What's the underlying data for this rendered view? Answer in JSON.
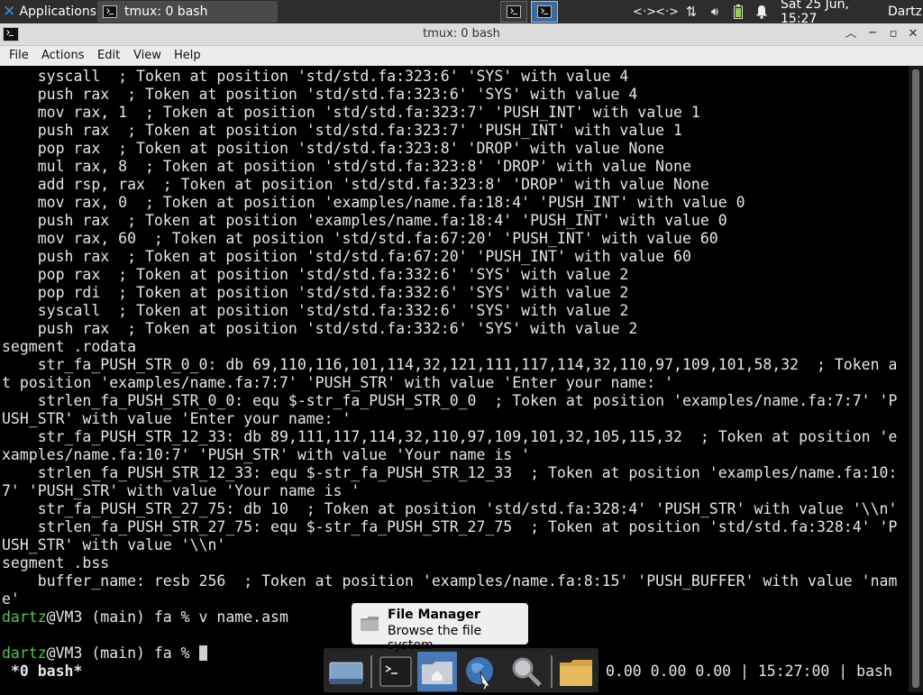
{
  "panel": {
    "applications_label": "Applications",
    "task_title": "tmux: 0 bash",
    "clock": "Sat 25 Jun, 15:27",
    "user": "Dartz"
  },
  "window": {
    "title": "tmux: 0 bash",
    "menu": [
      "File",
      "Actions",
      "Edit",
      "View",
      "Help"
    ]
  },
  "terminal": {
    "lines": [
      "    syscall  ; Token at position 'std/std.fa:323:6' 'SYS' with value 4",
      "    push rax  ; Token at position 'std/std.fa:323:6' 'SYS' with value 4",
      "    mov rax, 1  ; Token at position 'std/std.fa:323:7' 'PUSH_INT' with value 1",
      "    push rax  ; Token at position 'std/std.fa:323:7' 'PUSH_INT' with value 1",
      "    pop rax  ; Token at position 'std/std.fa:323:8' 'DROP' with value None",
      "    mul rax, 8  ; Token at position 'std/std.fa:323:8' 'DROP' with value None",
      "    add rsp, rax  ; Token at position 'std/std.fa:323:8' 'DROP' with value None",
      "    mov rax, 0  ; Token at position 'examples/name.fa:18:4' 'PUSH_INT' with value 0",
      "    push rax  ; Token at position 'examples/name.fa:18:4' 'PUSH_INT' with value 0",
      "    mov rax, 60  ; Token at position 'std/std.fa:67:20' 'PUSH_INT' with value 60",
      "    push rax  ; Token at position 'std/std.fa:67:20' 'PUSH_INT' with value 60",
      "    pop rax  ; Token at position 'std/std.fa:332:6' 'SYS' with value 2",
      "    pop rdi  ; Token at position 'std/std.fa:332:6' 'SYS' with value 2",
      "    syscall  ; Token at position 'std/std.fa:332:6' 'SYS' with value 2",
      "    push rax  ; Token at position 'std/std.fa:332:6' 'SYS' with value 2",
      "segment .rodata",
      "    str_fa_PUSH_STR_0_0: db 69,110,116,101,114,32,121,111,117,114,32,110,97,109,101,58,32  ; Token a",
      "t position 'examples/name.fa:7:7' 'PUSH_STR' with value 'Enter your name: '",
      "    strlen_fa_PUSH_STR_0_0: equ $-str_fa_PUSH_STR_0_0  ; Token at position 'examples/name.fa:7:7' 'P",
      "USH_STR' with value 'Enter your name: '",
      "    str_fa_PUSH_STR_12_33: db 89,111,117,114,32,110,97,109,101,32,105,115,32  ; Token at position 'e",
      "xamples/name.fa:10:7' 'PUSH_STR' with value 'Your name is '",
      "    strlen_fa_PUSH_STR_12_33: equ $-str_fa_PUSH_STR_12_33  ; Token at position 'examples/name.fa:10:",
      "7' 'PUSH_STR' with value 'Your name is '",
      "    str_fa_PUSH_STR_27_75: db 10  ; Token at position 'std/std.fa:328:4' 'PUSH_STR' with value '\\\\n'",
      "    strlen_fa_PUSH_STR_27_75: equ $-str_fa_PUSH_STR_27_75  ; Token at position 'std/std.fa:328:4' 'P",
      "USH_STR' with value '\\\\n'",
      "segment .bss",
      "    buffer_name: resb 256  ; Token at position 'examples/name.fa:8:15' 'PUSH_BUFFER' with value 'nam",
      "e'"
    ],
    "prompt1_user": "dartz",
    "prompt1_rest": "@VM3 (main) fa % v name.asm",
    "prompt2_user": "dartz",
    "prompt2_rest": "@VM3 (main) fa % ",
    "tmux_window": " *0 bash*",
    "tmux_status": "0.00 0.00 0.00 | 15:27:00 | bash"
  },
  "tooltip": {
    "title": "File Manager",
    "subtitle": "Browse the file system"
  }
}
